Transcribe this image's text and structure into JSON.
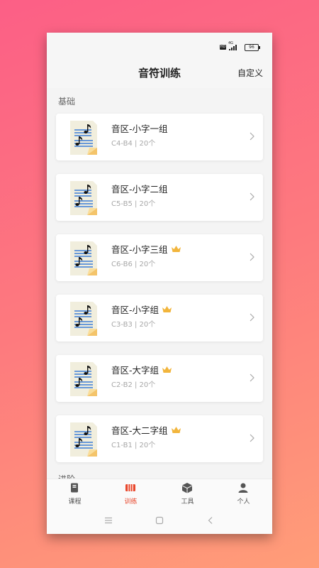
{
  "status": {
    "hd": "HD",
    "network": "4G",
    "battery": "96"
  },
  "header": {
    "title": "音符训练",
    "custom_label": "自定义"
  },
  "sections": [
    {
      "label": "基础"
    },
    {
      "label": "进阶"
    }
  ],
  "cards": [
    {
      "title": "音区-小字一组",
      "meta": "C4-B4 | 20个",
      "premium": false
    },
    {
      "title": "音区-小字二组",
      "meta": "C5-B5 | 20个",
      "premium": false
    },
    {
      "title": "音区-小字三组",
      "meta": "C6-B6 | 20个",
      "premium": true
    },
    {
      "title": "音区-小字组",
      "meta": "C3-B3 | 20个",
      "premium": true
    },
    {
      "title": "音区-大字组",
      "meta": "C2-B2 | 20个",
      "premium": true
    },
    {
      "title": "音区-大二字组",
      "meta": "C1-B1 | 20个",
      "premium": true
    }
  ],
  "tabs": [
    {
      "label": "课程",
      "icon": "book-icon",
      "active": false
    },
    {
      "label": "训练",
      "icon": "piano-icon",
      "active": true
    },
    {
      "label": "工具",
      "icon": "box-icon",
      "active": false
    },
    {
      "label": "个人",
      "icon": "person-icon",
      "active": false
    }
  ],
  "colors": {
    "accent": "#e8472c",
    "crown": "#f2b53c",
    "card_bg": "#ffffff",
    "note_blue": "#3b7dd8"
  }
}
